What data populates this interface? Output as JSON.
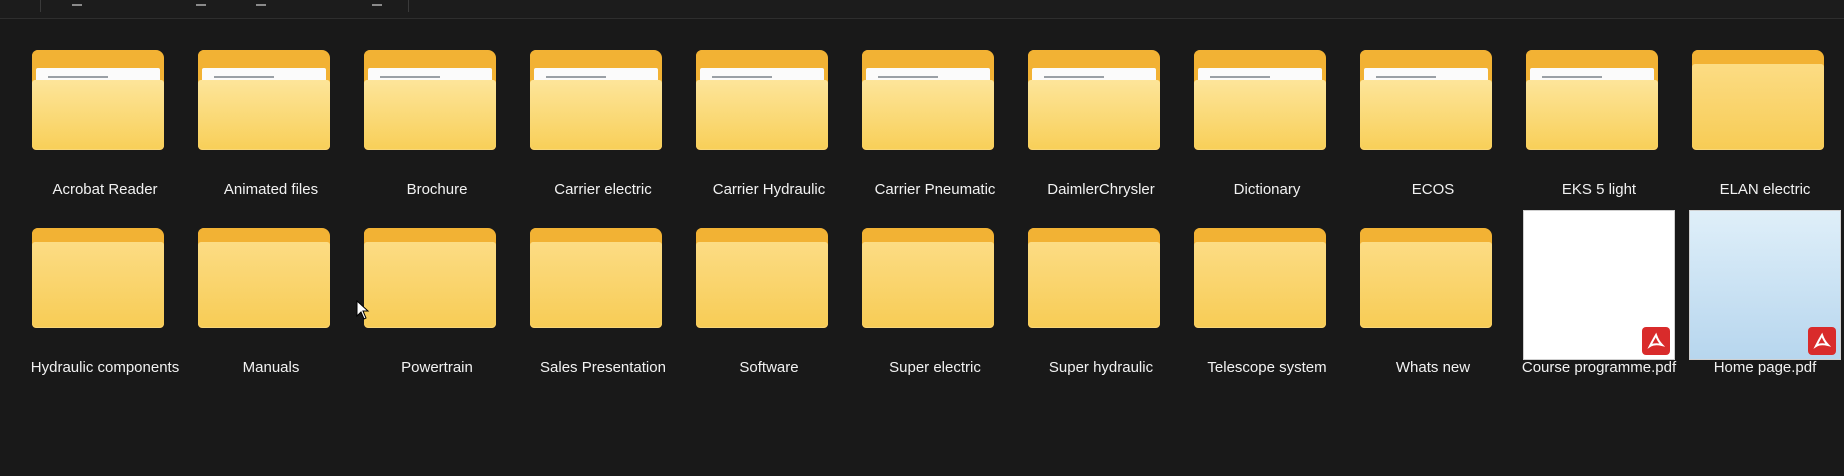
{
  "window": {
    "items": [
      {
        "label": "Acrobat Reader",
        "type": "folder",
        "preview": true
      },
      {
        "label": "Animated files",
        "type": "folder",
        "preview": true
      },
      {
        "label": "Brochure",
        "type": "folder",
        "preview": true
      },
      {
        "label": "Carrier electric",
        "type": "folder",
        "preview": true
      },
      {
        "label": "Carrier Hydraulic",
        "type": "folder",
        "preview": true
      },
      {
        "label": "Carrier Pneumatic",
        "type": "folder",
        "preview": true
      },
      {
        "label": "DaimlerChrysler",
        "type": "folder",
        "preview": true
      },
      {
        "label": "Dictionary",
        "type": "folder",
        "preview": true
      },
      {
        "label": "ECOS",
        "type": "folder",
        "preview": true
      },
      {
        "label": "EKS 5 light",
        "type": "folder",
        "preview": true
      },
      {
        "label": "ELAN electric",
        "type": "folder",
        "preview": false
      },
      {
        "label": "Hydraulic components",
        "type": "folder",
        "preview": false
      },
      {
        "label": "Manuals",
        "type": "folder",
        "preview": false
      },
      {
        "label": "Powertrain",
        "type": "folder",
        "preview": false
      },
      {
        "label": "Sales Presentation",
        "type": "folder",
        "preview": false
      },
      {
        "label": "Software",
        "type": "folder",
        "preview": false
      },
      {
        "label": "Super electric",
        "type": "folder",
        "preview": false
      },
      {
        "label": "Super hydraulic",
        "type": "folder",
        "preview": false
      },
      {
        "label": "Telescope system",
        "type": "folder",
        "preview": false
      },
      {
        "label": "Whats new",
        "type": "folder",
        "preview": false
      },
      {
        "label": "Course programme.pdf",
        "type": "pdf",
        "thumb": "white"
      },
      {
        "label": "Home page.pdf",
        "type": "pdf",
        "thumb": "blue"
      }
    ]
  },
  "colors": {
    "background": "#191919",
    "folder": "#f2b234",
    "folder_front": "#f8cf58",
    "pdf_badge": "#d92b2b"
  },
  "icons": {
    "folder": "folder-icon",
    "pdf": "pdf-file-icon",
    "cursor": "mouse-pointer-icon"
  }
}
